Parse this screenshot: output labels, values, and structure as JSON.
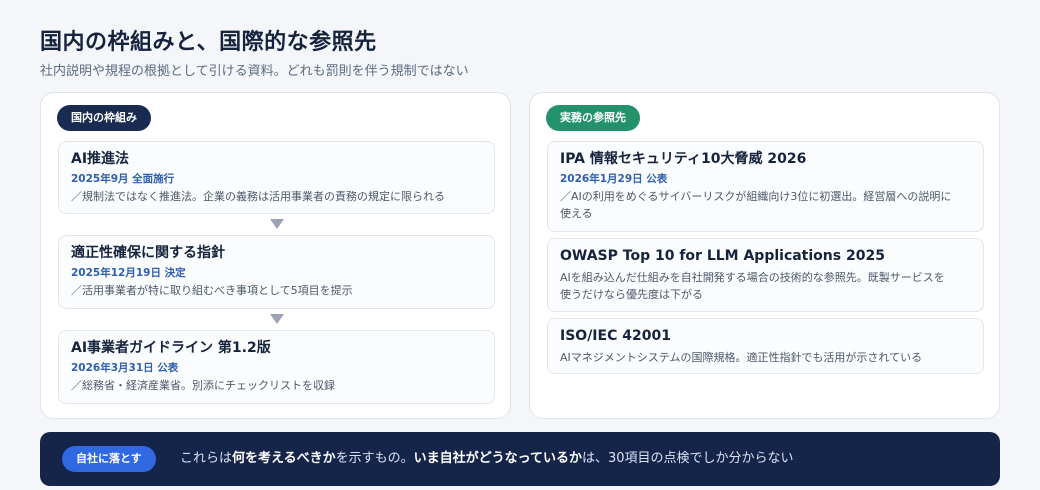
{
  "header": {
    "title": "国内の枠組みと、国際的な参照先",
    "subtitle": "社内説明や規程の根拠として引ける資料。どれも罰則を伴う規制ではない"
  },
  "left_panel": {
    "tag": "国内の枠組み",
    "items": [
      {
        "title": "AI推進法",
        "meta": "2025年9月  全面施行",
        "desc": "／規制法ではなく推進法。企業の義務は活用事業者の責務の規定に限られる"
      },
      {
        "title": "適正性確保に関する指針",
        "meta": "2025年12月19日  決定",
        "desc": "／活用事業者が特に取り組むべき事項として5項目を提示"
      },
      {
        "title": "AI事業者ガイドライン 第1.2版",
        "meta": "2026年3月31日  公表",
        "desc": "／総務省・経済産業省。別添にチェックリストを収録"
      }
    ]
  },
  "right_panel": {
    "tag": "実務の参照先",
    "items": [
      {
        "title": "IPA 情報セキュリティ10大脅威 2026",
        "meta": "2026年1月29日  公表",
        "desc_line1": "／AIの利用をめぐるサイバーリスクが組織向け3位に初選出。経営層への説明に",
        "desc_line2": "使える"
      },
      {
        "title": "OWASP Top 10 for LLM Applications 2025",
        "desc_line1": "AIを組み込んだ仕組みを自社開発する場合の技術的な参照先。既製サービスを",
        "desc_line2": "使うだけなら優先度は下がる"
      },
      {
        "title": "ISO/IEC 42001",
        "desc_line1": "AIマネジメントシステムの国際規格。適正性指針でも活用が示されている"
      }
    ]
  },
  "banner": {
    "tag": "自社に落とす",
    "text_1": "これらは",
    "text_2": "何を考えるべきか",
    "text_3": "を示すもの。",
    "text_4": "いま自社がどうなっているか",
    "text_5": "は、30項目の点検でしか分からない"
  },
  "colors": {
    "navy": "#1a2b52",
    "green": "#23926b",
    "blue": "#2f68e0",
    "meta_blue": "#2f5fb0"
  }
}
